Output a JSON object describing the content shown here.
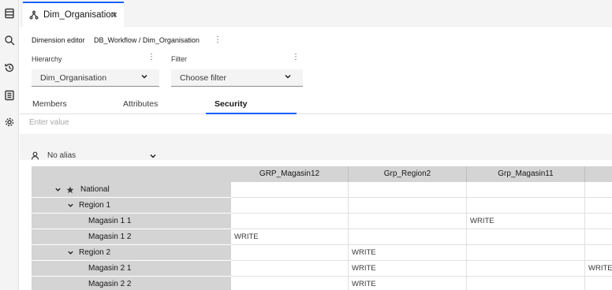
{
  "rail": {
    "icons": [
      "database-icon",
      "search-icon",
      "history-icon",
      "list-icon",
      "settings-icon"
    ]
  },
  "tab": {
    "title": "Dim_Organisation",
    "close": "×"
  },
  "editor": {
    "label": "Dimension editor",
    "path": "DB_Workflow / Dim_Organisation",
    "menu": "⋮"
  },
  "hierarchy": {
    "label": "Hierarchy",
    "value": "Dim_Organisation"
  },
  "filter": {
    "label": "Filter",
    "value": "Choose filter"
  },
  "subtabs": {
    "members": "Members",
    "attributes": "Attributes",
    "security": "Security"
  },
  "search": {
    "placeholder": "Enter value"
  },
  "alias": {
    "label": "No alias"
  },
  "grid": {
    "columns": [
      "GRP_Magasin12",
      "Grp_Region2",
      "Grp_Magasin11",
      ""
    ],
    "rows": [
      {
        "label": "National",
        "level": 0,
        "expand": true,
        "star": true,
        "cells": [
          "",
          "",
          "",
          ""
        ]
      },
      {
        "label": "Region 1",
        "level": 1,
        "expand": true,
        "star": false,
        "cells": [
          "",
          "",
          "",
          ""
        ]
      },
      {
        "label": "Magasin 1 1",
        "level": 2,
        "expand": false,
        "star": false,
        "cells": [
          "",
          "",
          "WRITE",
          ""
        ]
      },
      {
        "label": "Magasin 1 2",
        "level": 2,
        "expand": false,
        "star": false,
        "cells": [
          "WRITE",
          "",
          "",
          ""
        ]
      },
      {
        "label": "Region 2",
        "level": 1,
        "expand": true,
        "star": false,
        "cells": [
          "",
          "WRITE",
          "",
          ""
        ]
      },
      {
        "label": "Magasin 2 1",
        "level": 2,
        "expand": false,
        "star": false,
        "cells": [
          "",
          "WRITE",
          "",
          "WRITE"
        ]
      },
      {
        "label": "Magasin 2 2",
        "level": 2,
        "expand": false,
        "star": false,
        "cells": [
          "",
          "WRITE",
          "",
          ""
        ]
      }
    ]
  }
}
